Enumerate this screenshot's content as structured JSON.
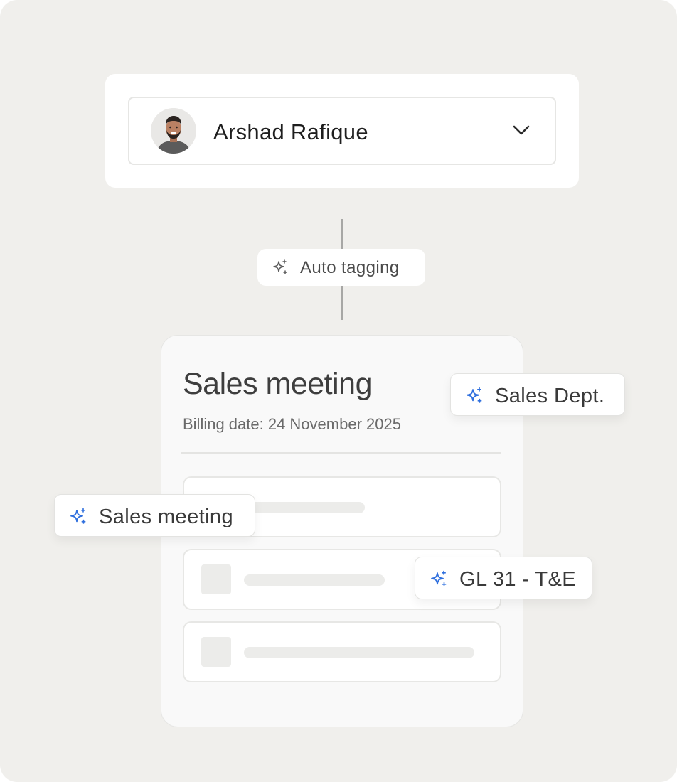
{
  "user": {
    "name": "Arshad Rafique",
    "avatar_icon": "user-avatar-photo",
    "dropdown_icon": "chevron-down-icon"
  },
  "auto_tagging": {
    "label": "Auto tagging",
    "icon": "sparkle-icon"
  },
  "document": {
    "title": "Sales meeting",
    "billing_date": "Billing date: 24 November 2025",
    "placeholder_rows": 3
  },
  "tags": {
    "department": "Sales Dept.",
    "category": "Sales meeting",
    "gl_account": "GL 31 - T&E"
  },
  "colors": {
    "background": "#f0efec",
    "card": "#ffffff",
    "accent_sparkle": "#2f6fde",
    "muted_sparkle": "#5a5a5a"
  }
}
